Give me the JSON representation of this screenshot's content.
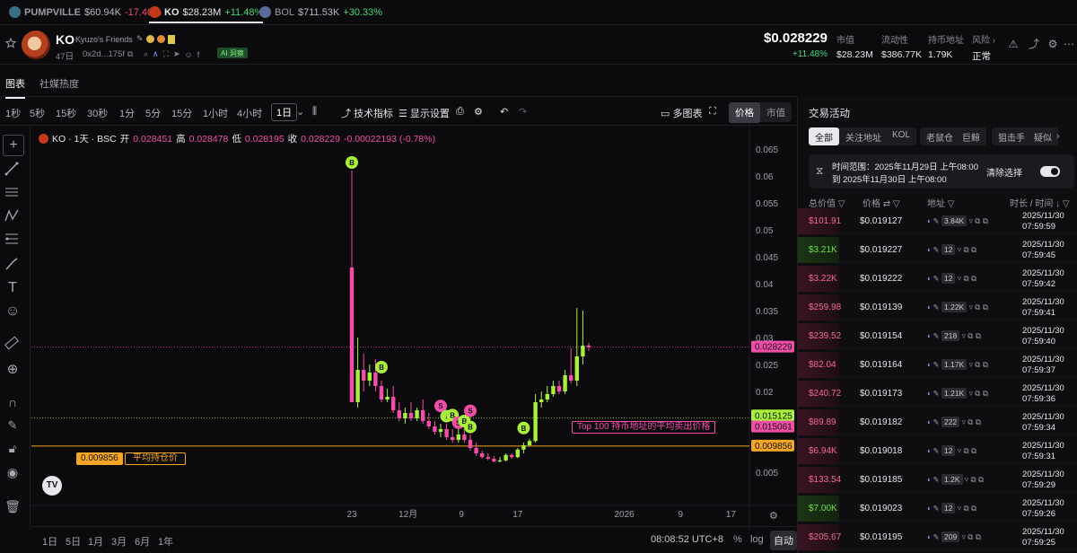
{
  "ticker": [
    {
      "sym": "PUMPVILLE",
      "price": "$60.94K",
      "change": "-17.40%",
      "dir": "down",
      "icon": "globe-icon"
    },
    {
      "sym": "KO",
      "price": "$28.23M",
      "change": "+11.48%",
      "dir": "up",
      "icon": "ko-logo-icon"
    },
    {
      "sym": "BOL",
      "price": "$711.53K",
      "change": "+30.33%",
      "dir": "up",
      "icon": "bol-logo-icon"
    }
  ],
  "token": {
    "symbol": "KO",
    "name": "Kyuzo's Friends",
    "age": "47日",
    "address": "0x2d...175f",
    "ai_badge": "AI 洞察",
    "price": "$0.028229",
    "change": "+11.48%",
    "stats": [
      {
        "label": "市值",
        "value": "$28.23M"
      },
      {
        "label": "流动性",
        "value": "$386.77K"
      },
      {
        "label": "持币地址",
        "value": "1.79K"
      },
      {
        "label": "风险 ›",
        "value": "正常"
      }
    ]
  },
  "tabs": [
    "图表",
    "社媒热度"
  ],
  "toolbar": {
    "intervals": [
      "1秒",
      "5秒",
      "15秒",
      "30秒",
      "1分",
      "5分",
      "15分",
      "1小时",
      "4小时",
      "1日"
    ],
    "selected_interval": "1日",
    "indicators": "技术指标",
    "display_settings": "显示设置",
    "multi_chart": "多图表",
    "price_toggle": [
      "价格",
      "市值"
    ]
  },
  "chart_data": {
    "type": "candlestick",
    "legend": {
      "symbol": "KO · 1天 · BSC",
      "open_label": "开",
      "open": "0.028451",
      "high_label": "高",
      "high": "0.028478",
      "low_label": "低",
      "low": "0.028195",
      "close_label": "收",
      "close": "0.028229",
      "change": "-0.00022193 (-0.78%)"
    },
    "ylim": [
      0.002,
      0.067
    ],
    "y_ticks": [
      "0.065",
      "0.06",
      "0.055",
      "0.05",
      "0.045",
      "0.04",
      "0.035",
      "0.03",
      "0.025",
      "0.02",
      "0.015",
      "0.01",
      "0.005"
    ],
    "x_ticks": [
      "23",
      "12月",
      "9",
      "17",
      "2026",
      "9",
      "17"
    ],
    "price_tags": [
      {
        "text": "0.028229",
        "value": 0.028229,
        "color": "#f24ea8"
      },
      {
        "text": "0.015125",
        "value": 0.015125,
        "color": "#a8f03c"
      },
      {
        "text": "0.015061",
        "value": 0.015061,
        "color": "#f24ea8"
      },
      {
        "text": "0.009856",
        "value": 0.009856,
        "color": "#f5a623"
      }
    ],
    "avg_cost_line": {
      "value": 0.009856,
      "label": "0.009856",
      "text": "平均持仓价"
    },
    "top100_line": {
      "value": 0.015061,
      "text": "Top 100 持币地址的平均卖出价格"
    },
    "candles": [
      {
        "o": 0.043,
        "h": 0.061,
        "l": 0.018,
        "c": 0.018
      },
      {
        "o": 0.018,
        "h": 0.03,
        "l": 0.017,
        "c": 0.024
      },
      {
        "o": 0.024,
        "h": 0.027,
        "l": 0.02,
        "c": 0.022
      },
      {
        "o": 0.022,
        "h": 0.025,
        "l": 0.021,
        "c": 0.0235
      },
      {
        "o": 0.0235,
        "h": 0.026,
        "l": 0.02,
        "c": 0.021
      },
      {
        "o": 0.021,
        "h": 0.022,
        "l": 0.018,
        "c": 0.0185
      },
      {
        "o": 0.0185,
        "h": 0.0205,
        "l": 0.018,
        "c": 0.019
      },
      {
        "o": 0.019,
        "h": 0.021,
        "l": 0.016,
        "c": 0.0165
      },
      {
        "o": 0.0165,
        "h": 0.018,
        "l": 0.0145,
        "c": 0.015
      },
      {
        "o": 0.015,
        "h": 0.017,
        "l": 0.014,
        "c": 0.016
      },
      {
        "o": 0.016,
        "h": 0.018,
        "l": 0.0145,
        "c": 0.015
      },
      {
        "o": 0.015,
        "h": 0.017,
        "l": 0.0145,
        "c": 0.0165
      },
      {
        "o": 0.0165,
        "h": 0.0185,
        "l": 0.014,
        "c": 0.0145
      },
      {
        "o": 0.0145,
        "h": 0.016,
        "l": 0.013,
        "c": 0.0135
      },
      {
        "o": 0.0135,
        "h": 0.0145,
        "l": 0.012,
        "c": 0.0125
      },
      {
        "o": 0.0125,
        "h": 0.014,
        "l": 0.0115,
        "c": 0.013
      },
      {
        "o": 0.013,
        "h": 0.014,
        "l": 0.011,
        "c": 0.0115
      },
      {
        "o": 0.0115,
        "h": 0.013,
        "l": 0.0105,
        "c": 0.011
      },
      {
        "o": 0.011,
        "h": 0.0135,
        "l": 0.0105,
        "c": 0.012
      },
      {
        "o": 0.012,
        "h": 0.013,
        "l": 0.0105,
        "c": 0.011
      },
      {
        "o": 0.011,
        "h": 0.012,
        "l": 0.009,
        "c": 0.0095
      },
      {
        "o": 0.0095,
        "h": 0.0105,
        "l": 0.008,
        "c": 0.0085
      },
      {
        "o": 0.0085,
        "h": 0.009,
        "l": 0.0075,
        "c": 0.0078
      },
      {
        "o": 0.0078,
        "h": 0.0085,
        "l": 0.0072,
        "c": 0.0075
      },
      {
        "o": 0.0075,
        "h": 0.008,
        "l": 0.0068,
        "c": 0.007
      },
      {
        "o": 0.007,
        "h": 0.0078,
        "l": 0.0068,
        "c": 0.0072
      },
      {
        "o": 0.0072,
        "h": 0.0085,
        "l": 0.007,
        "c": 0.0082
      },
      {
        "o": 0.0082,
        "h": 0.0085,
        "l": 0.0075,
        "c": 0.0078
      },
      {
        "o": 0.0078,
        "h": 0.0095,
        "l": 0.0076,
        "c": 0.0092
      },
      {
        "o": 0.0092,
        "h": 0.0105,
        "l": 0.0085,
        "c": 0.01
      },
      {
        "o": 0.01,
        "h": 0.0112,
        "l": 0.0098,
        "c": 0.0108
      },
      {
        "o": 0.0108,
        "h": 0.0195,
        "l": 0.0105,
        "c": 0.018
      },
      {
        "o": 0.018,
        "h": 0.02,
        "l": 0.017,
        "c": 0.0185
      },
      {
        "o": 0.0185,
        "h": 0.021,
        "l": 0.018,
        "c": 0.0195
      },
      {
        "o": 0.0195,
        "h": 0.022,
        "l": 0.019,
        "c": 0.021
      },
      {
        "o": 0.021,
        "h": 0.022,
        "l": 0.0195,
        "c": 0.02
      },
      {
        "o": 0.02,
        "h": 0.024,
        "l": 0.0195,
        "c": 0.023
      },
      {
        "o": 0.023,
        "h": 0.028,
        "l": 0.0215,
        "c": 0.022
      },
      {
        "o": 0.022,
        "h": 0.0355,
        "l": 0.021,
        "c": 0.0265
      },
      {
        "o": 0.0265,
        "h": 0.035,
        "l": 0.025,
        "c": 0.0285
      },
      {
        "o": 0.0285,
        "h": 0.029,
        "l": 0.0275,
        "c": 0.0282
      }
    ],
    "markers": [
      {
        "idx": 0,
        "side": "B",
        "value": 0.0625
      },
      {
        "idx": 5,
        "side": "B",
        "value": 0.0245
      },
      {
        "idx": 15,
        "side": "S",
        "value": 0.0173
      },
      {
        "idx": 16,
        "side": "I",
        "value": 0.0154
      },
      {
        "idx": 17,
        "side": "B",
        "value": 0.0156
      },
      {
        "idx": 18,
        "side": "S",
        "value": 0.0142
      },
      {
        "idx": 19,
        "side": "B",
        "value": 0.0145
      },
      {
        "idx": 20,
        "side": "S",
        "value": 0.0164
      },
      {
        "idx": 20,
        "side": "B",
        "value": 0.0134
      },
      {
        "idx": 29,
        "side": "B",
        "value": 0.0132
      }
    ]
  },
  "chart_bottom": {
    "ranges": [
      "1日",
      "5日",
      "1月",
      "3月",
      "6月",
      "1年"
    ],
    "clock": "08:08:52 UTC+8",
    "percent": "%",
    "log": "log",
    "auto": "自动"
  },
  "activity": {
    "title": "交易活动",
    "filters": [
      "全部",
      "关注地址",
      "KOL",
      "老鼠仓",
      "巨鲸",
      "狙击手",
      "疑似"
    ],
    "range_line1": "时间范围：2025年11月29日 上午08:00",
    "range_line2": "到 2025年11月30日 上午08:00",
    "clear": "清除选择",
    "columns": [
      "总价值 ▽",
      "价格 ⇄ ▽",
      "地址 ▽",
      "时长 / 时间 ↓ ▽"
    ],
    "rows": [
      {
        "total": "$101.91",
        "side": "sell",
        "price": "$0.019127",
        "count": "3.84K",
        "time1": "2025/11/30",
        "time2": "07:59:59"
      },
      {
        "total": "$3.21K",
        "side": "buy",
        "price": "$0.019227",
        "count": "12",
        "time1": "2025/11/30",
        "time2": "07:59:45"
      },
      {
        "total": "$3.22K",
        "side": "sell",
        "price": "$0.019222",
        "count": "12",
        "time1": "2025/11/30",
        "time2": "07:59:42"
      },
      {
        "total": "$259.98",
        "side": "sell",
        "price": "$0.019139",
        "count": "1.22K",
        "time1": "2025/11/30",
        "time2": "07:59:41"
      },
      {
        "total": "$239.52",
        "side": "sell",
        "price": "$0.019154",
        "count": "218",
        "time1": "2025/11/30",
        "time2": "07:59:40"
      },
      {
        "total": "$82.04",
        "side": "sell",
        "price": "$0.019164",
        "count": "1.17K",
        "time1": "2025/11/30",
        "time2": "07:59:37"
      },
      {
        "total": "$240.72",
        "side": "sell",
        "price": "$0.019173",
        "count": "1.21K",
        "time1": "2025/11/30",
        "time2": "07:59:36"
      },
      {
        "total": "$89.89",
        "side": "sell",
        "price": "$0.019182",
        "count": "222",
        "time1": "2025/11/30",
        "time2": "07:59:34"
      },
      {
        "total": "$6.94K",
        "side": "sell",
        "price": "$0.019018",
        "count": "12",
        "time1": "2025/11/30",
        "time2": "07:59:31"
      },
      {
        "total": "$133.54",
        "side": "sell",
        "price": "$0.019185",
        "count": "1.2K",
        "time1": "2025/11/30",
        "time2": "07:59:29"
      },
      {
        "total": "$7.00K",
        "side": "buy",
        "price": "$0.019023",
        "count": "12",
        "time1": "2025/11/30",
        "time2": "07:59:26"
      },
      {
        "total": "$205.67",
        "side": "sell",
        "price": "$0.019195",
        "count": "209",
        "time1": "2025/11/30",
        "time2": "07:59:25"
      },
      {
        "total": "$240.52",
        "side": "sell",
        "price": "$0.019207",
        "count": "1.24K",
        "time1": "2025/11/30",
        "time2": "07:59:23"
      }
    ]
  }
}
